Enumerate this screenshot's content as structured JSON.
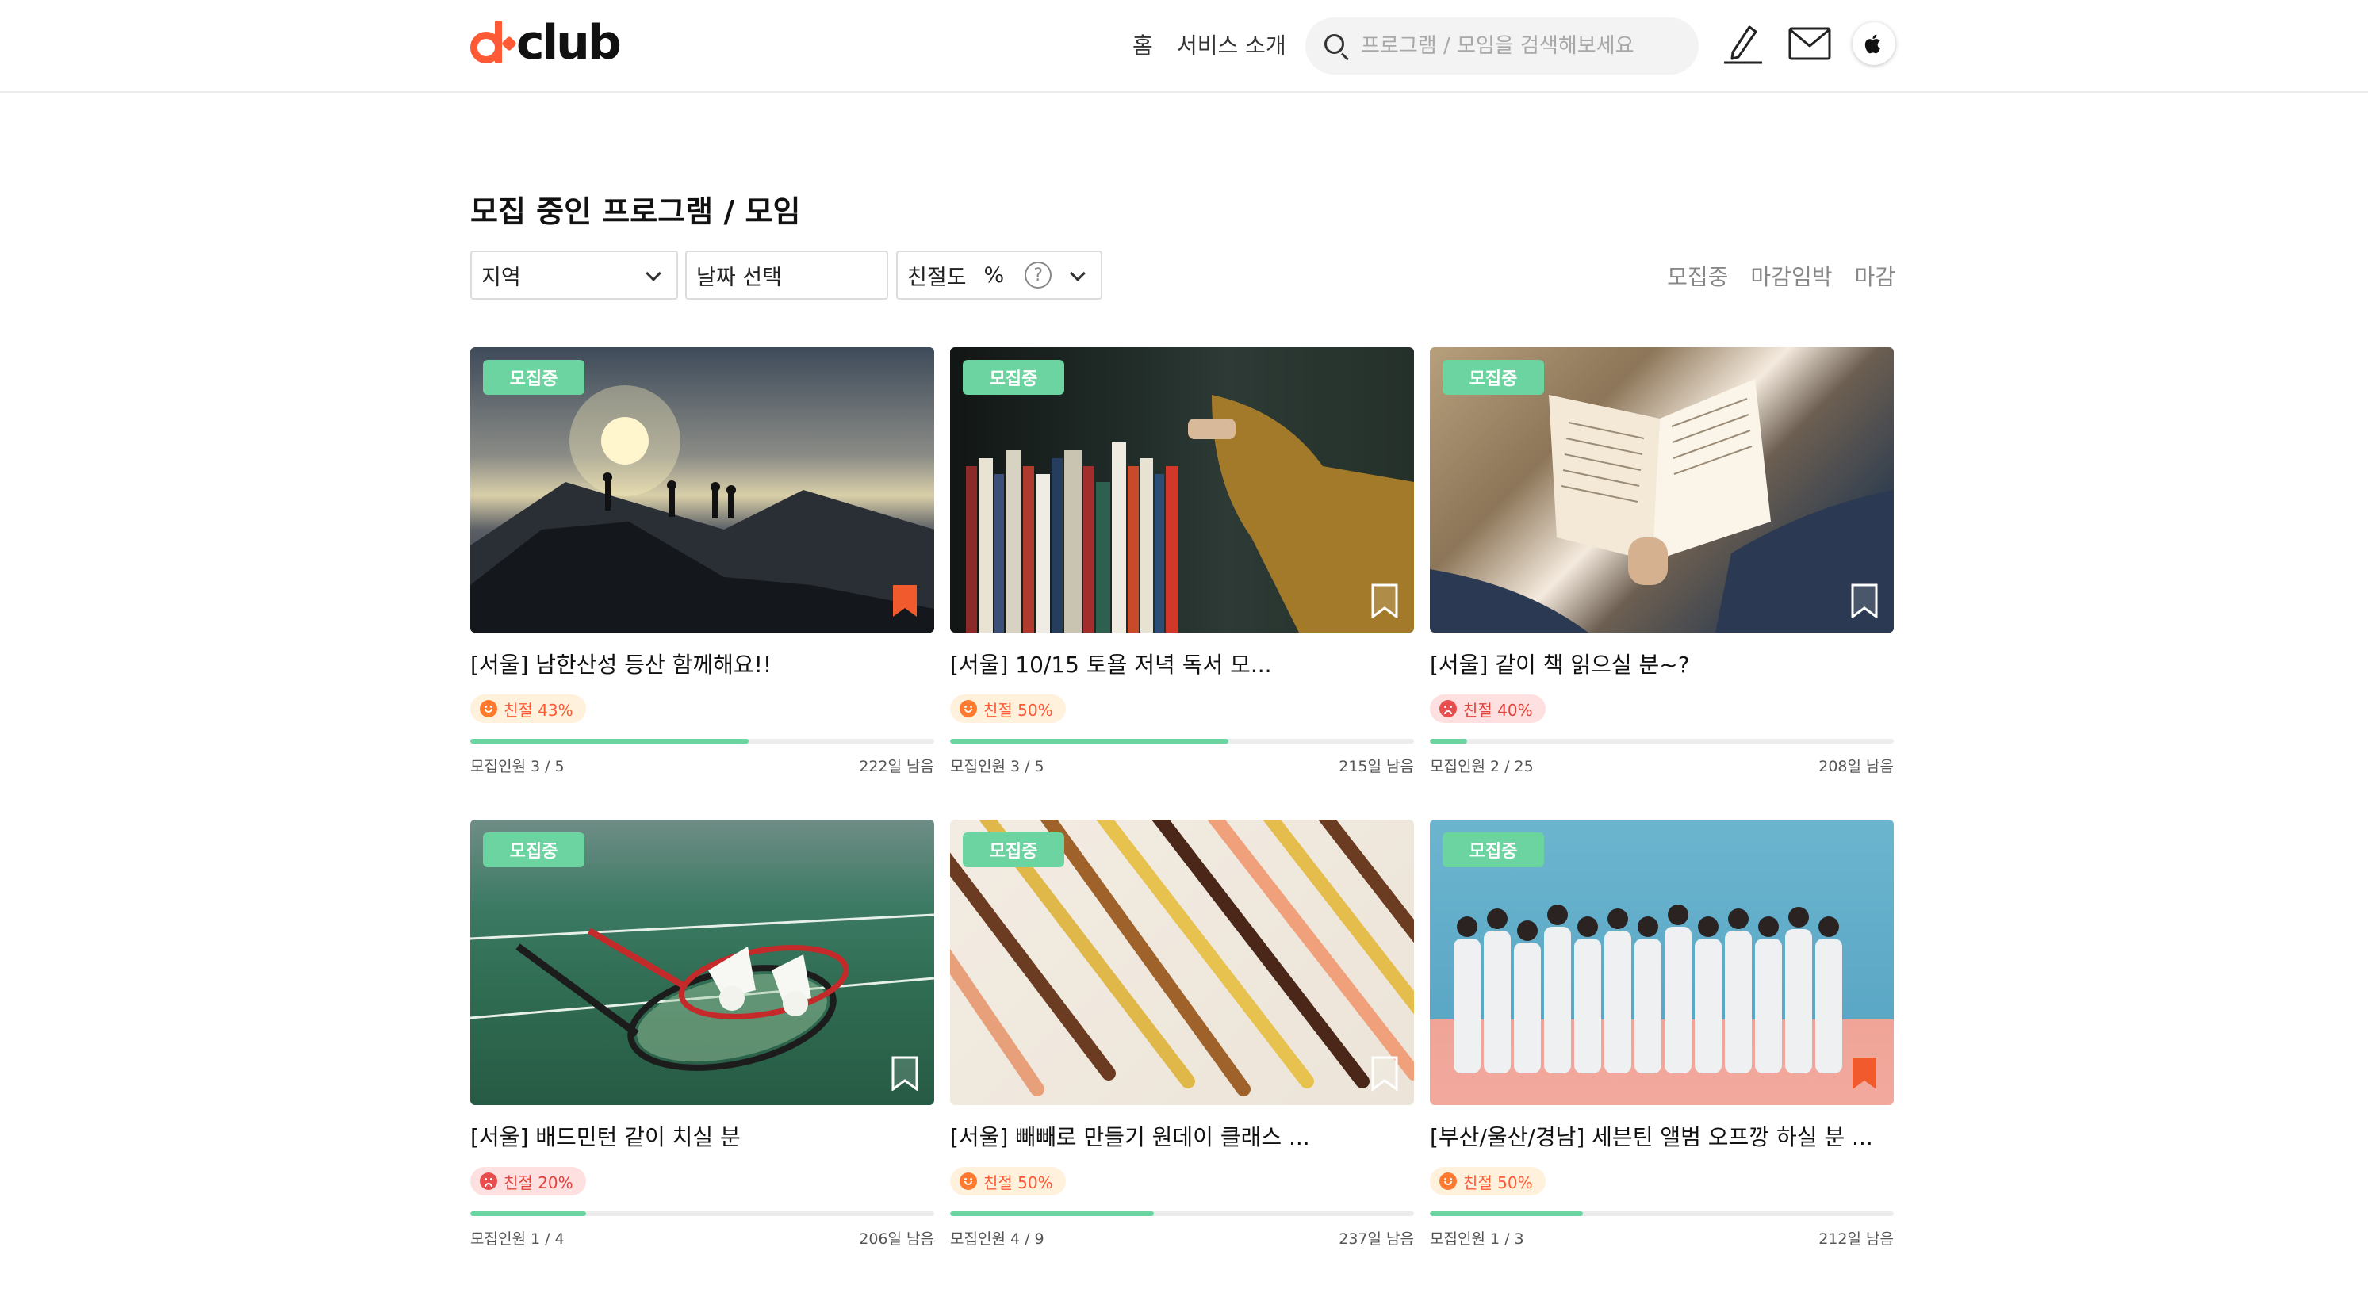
{
  "header": {
    "logo_text": "club",
    "nav": {
      "home": "홈",
      "about": "서비스 소개"
    },
    "search": {
      "placeholder": "프로그램 / 모임을 검색해보세요"
    }
  },
  "page_title": "모집 중인 프로그램 / 모임",
  "filters": {
    "region": "지역",
    "date": "날짜 선택",
    "kindness_label": "친절도",
    "kindness_unit": "%",
    "help": "?"
  },
  "status_tabs": [
    "모집중",
    "마감임박",
    "마감"
  ],
  "colors": {
    "accent": "#ff5a36",
    "badge_green": "#6cd4a0",
    "progress_green": "#6cd4a0"
  },
  "cards": [
    {
      "badge": "모집중",
      "title": "[서울] 남한산성 등산 함께해요!!",
      "kindness": "친절 43%",
      "mood": "good",
      "progress": 0.6,
      "members": "모집인원 3 / 5",
      "days_left": "222일 남음",
      "bookmarked": true,
      "image": "hikers-silhouette-sunset"
    },
    {
      "badge": "모집중",
      "title": "[서울] 10/15 토욜 저녁 독서 모...",
      "kindness": "친절 50%",
      "mood": "good",
      "progress": 0.6,
      "members": "모집인원 3 / 5",
      "days_left": "215일 남음",
      "bookmarked": false,
      "image": "bookshelf"
    },
    {
      "badge": "모집중",
      "title": "[서울] 같이 책 읽으실 분~?",
      "kindness": "친절 40%",
      "mood": "bad",
      "progress": 0.08,
      "members": "모집인원 2 / 25",
      "days_left": "208일 남음",
      "bookmarked": false,
      "image": "person-reading-book"
    },
    {
      "badge": "모집중",
      "title": "[서울] 배드민턴 같이 치실 분",
      "kindness": "친절 20%",
      "mood": "bad",
      "progress": 0.25,
      "members": "모집인원 1 / 4",
      "days_left": "206일 남음",
      "bookmarked": false,
      "image": "badminton-rackets"
    },
    {
      "badge": "모집중",
      "title": "[서울] 빼빼로 만들기 원데이 클래스 ...",
      "kindness": "친절 50%",
      "mood": "good",
      "progress": 0.44,
      "members": "모집인원 4 / 9",
      "days_left": "237일 남음",
      "bookmarked": false,
      "image": "pepero-sticks"
    },
    {
      "badge": "모집중",
      "title": "[부산/울산/경남] 세븐틴 앨범 오프깡 하실 분 ...",
      "kindness": "친절 50%",
      "mood": "good",
      "progress": 0.33,
      "members": "모집인원 1 / 3",
      "days_left": "212일 남음",
      "bookmarked": true,
      "image": "group-photo"
    }
  ]
}
